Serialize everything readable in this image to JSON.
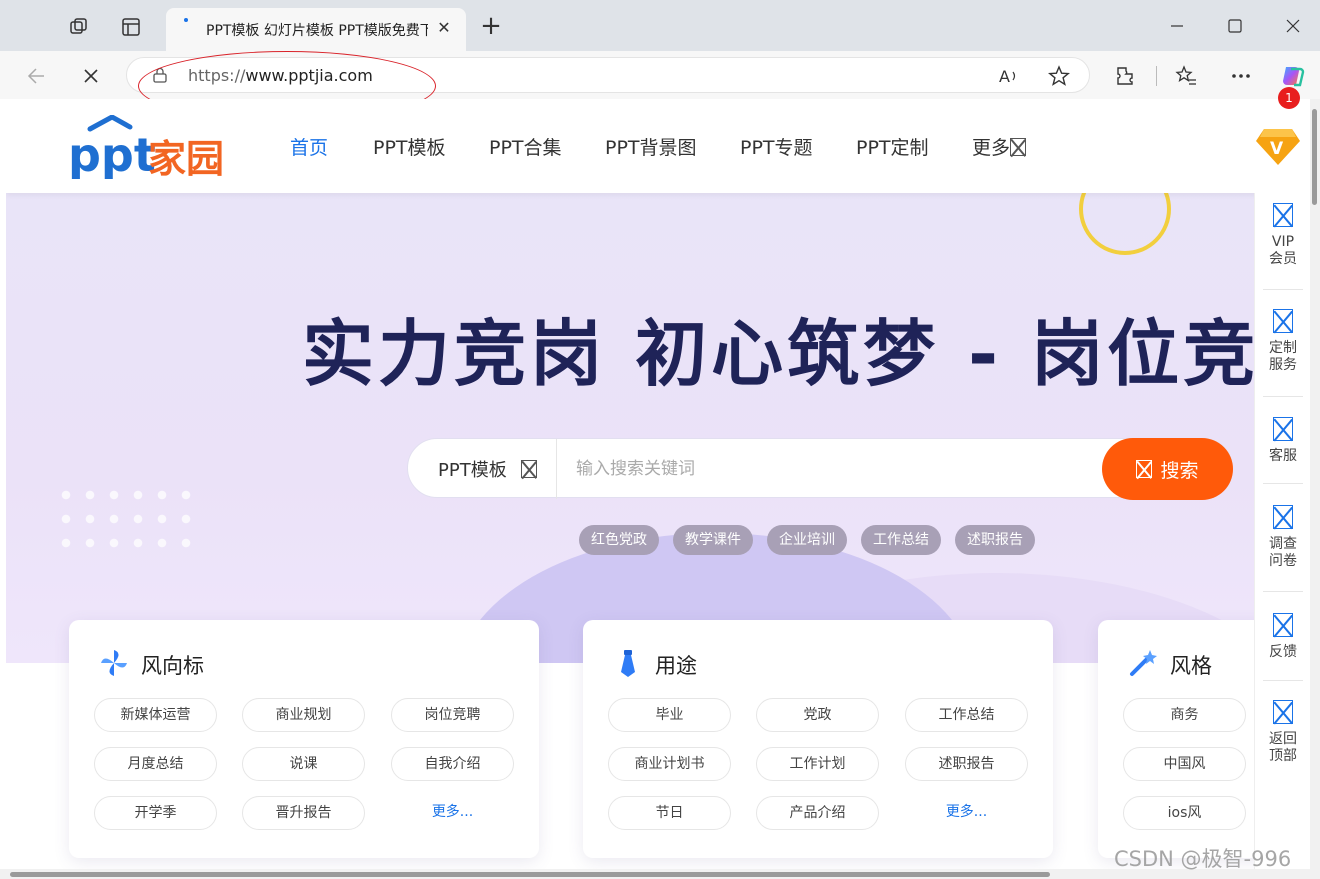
{
  "browser": {
    "tab_title": "PPT模板 幻灯片模板 PPT模版免费下载",
    "new_tab": "+",
    "tab_close": "✕",
    "url_prefix": "https://",
    "url_host": "www.pptjia.com"
  },
  "site": {
    "logo_text": "ppt家园",
    "nav": [
      {
        "label": "首页"
      },
      {
        "label": "PPT模板"
      },
      {
        "label": "PPT合集"
      },
      {
        "label": "PPT背景图"
      },
      {
        "label": "PPT专题"
      },
      {
        "label": "PPT定制"
      },
      {
        "label": "更多"
      }
    ],
    "vip_badge_letter": "V"
  },
  "hero": {
    "title": "实力竞岗  初心筑梦 - 岗位竞",
    "search": {
      "type_label": "PPT模板",
      "placeholder": "输入搜索关键词",
      "button_label": "搜索"
    },
    "tags": [
      "红色党政",
      "教学课件",
      "企业培训",
      "工作总结",
      "述职报告"
    ]
  },
  "cards": [
    {
      "title": "风向标",
      "icon": "pinwheel-icon",
      "items": [
        "新媒体运营",
        "商业规划",
        "岗位竞聘",
        "月度总结",
        "说课",
        "自我介绍",
        "开学季",
        "晋升报告",
        "更多..."
      ]
    },
    {
      "title": "用途",
      "icon": "tie-icon",
      "items": [
        "毕业",
        "党政",
        "工作总结",
        "商业计划书",
        "工作计划",
        "述职报告",
        "节日",
        "产品介绍",
        "更多..."
      ]
    },
    {
      "title": "风格",
      "icon": "magic-wand-icon",
      "items": [
        "商务",
        "中国风",
        "ios风"
      ]
    }
  ],
  "side_panel": {
    "notification_count": "1",
    "items": [
      {
        "line1": "VIP",
        "line2": "会员"
      },
      {
        "line1": "定制",
        "line2": "服务"
      },
      {
        "line1": "客服",
        "line2": ""
      },
      {
        "line1": "调查",
        "line2": "问卷"
      },
      {
        "line1": "反馈",
        "line2": ""
      },
      {
        "line1": "返回",
        "line2": "顶部"
      }
    ]
  },
  "watermark": "CSDN @极智-996",
  "colors": {
    "accent": "#1a73e8",
    "search_button": "#ff5a0a",
    "hero_title": "#1f2358",
    "annotation": "#d9232a"
  }
}
